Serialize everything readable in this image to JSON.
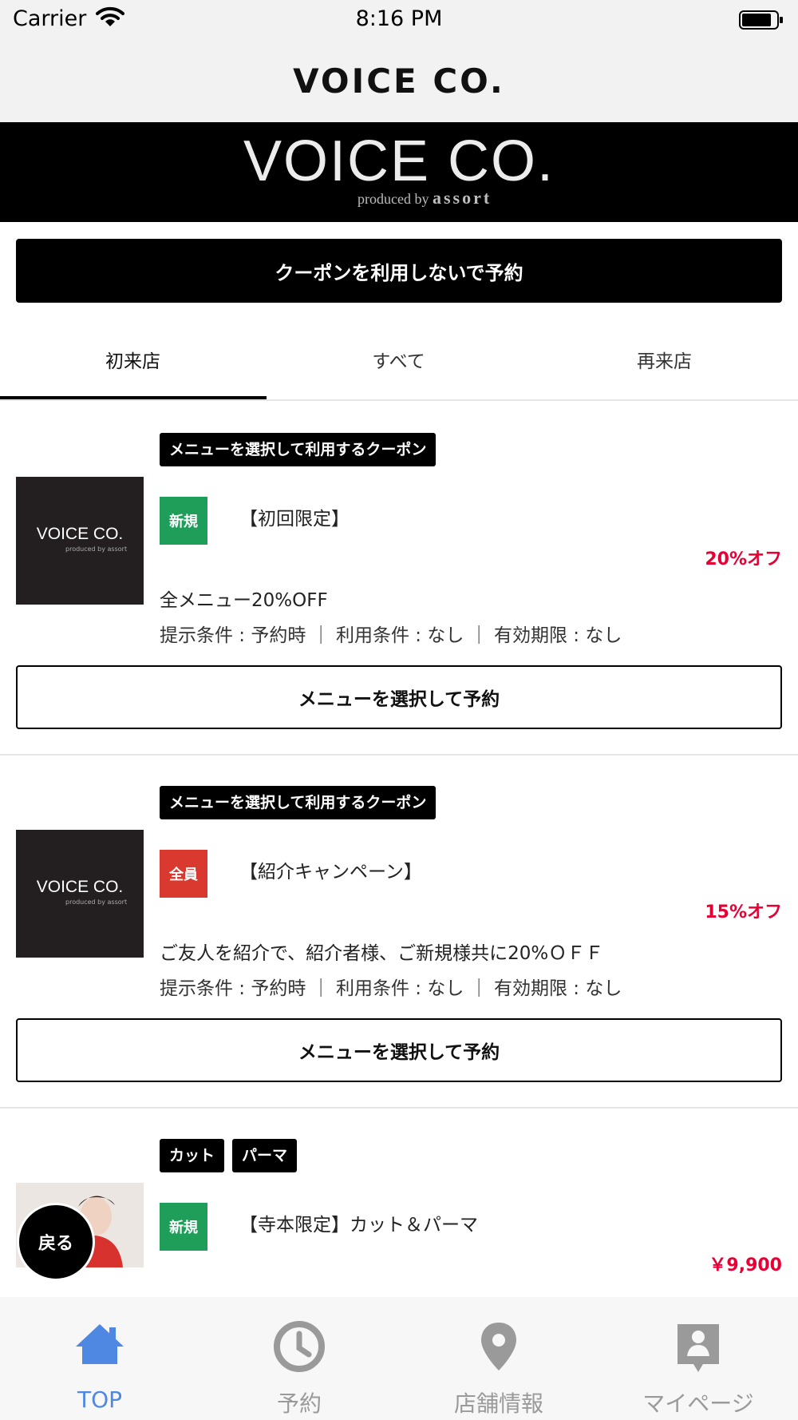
{
  "status_bar": {
    "carrier": "Carrier",
    "time": "8:16 PM"
  },
  "header": {
    "title": "VOICE CO."
  },
  "banner": {
    "logo_text": "VOICE CO.",
    "sub_prefix": "produced by",
    "sub_brand": "assort"
  },
  "no_coupon_button": "クーポンを利用しないで予約",
  "tabs": [
    {
      "label": "初来店"
    },
    {
      "label": "すべて"
    },
    {
      "label": "再来店"
    }
  ],
  "coupons": [
    {
      "tags": [
        "メニューを選択して利用するクーポン"
      ],
      "badge": "新規",
      "badge_color": "#1f9e5a",
      "thumb_logo": "VOICE CO.",
      "thumb_sub": "produced by assort",
      "title": "【初回限定】",
      "discount": "20%オフ",
      "description": "全メニュー20%OFF",
      "conditions": "提示条件 : 予約時 ｜ 利用条件 : なし ｜ 有効期限 : なし",
      "button": "メニューを選択して予約"
    },
    {
      "tags": [
        "メニューを選択して利用するクーポン"
      ],
      "badge": "全員",
      "badge_color": "#d9392e",
      "thumb_logo": "VOICE CO.",
      "thumb_sub": "produced by assort",
      "title": "【紹介キャンペーン】",
      "discount": "15%オフ",
      "description": "ご友人を紹介で、紹介者様、ご新規様共に20%ＯＦＦ",
      "conditions": "提示条件 : 予約時 ｜ 利用条件 : なし ｜ 有効期限 : なし",
      "button": "メニューを選択して予約"
    },
    {
      "tags": [
        "カット",
        "パーマ"
      ],
      "badge": "新規",
      "badge_color": "#1f9e5a",
      "title": "【寺本限定】カット＆パーマ",
      "price": "￥9,900"
    }
  ],
  "back_button": "戻る",
  "tabbar": [
    {
      "label": "TOP",
      "icon": "home-icon",
      "active": true
    },
    {
      "label": "予約",
      "icon": "clock-icon",
      "active": false
    },
    {
      "label": "店舗情報",
      "icon": "map-pin-icon",
      "active": false
    },
    {
      "label": "マイページ",
      "icon": "profile-card-icon",
      "active": false
    }
  ],
  "colors": {
    "accent_blue": "#4f88e3",
    "discount_red": "#e60033",
    "inactive_gray": "#9a9a9a"
  }
}
